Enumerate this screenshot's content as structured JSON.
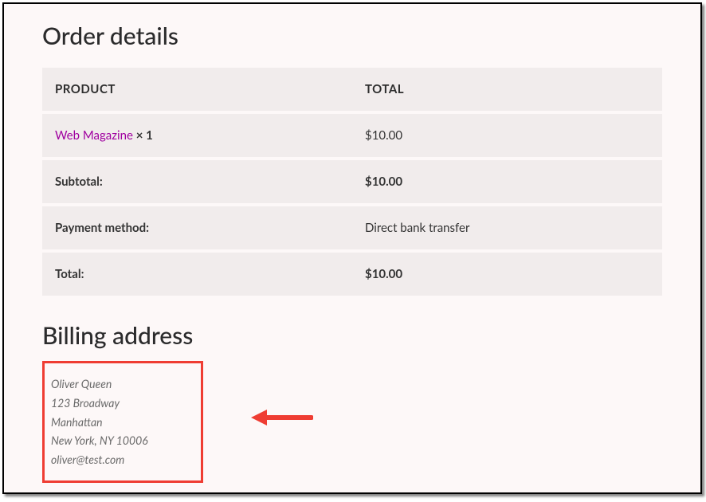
{
  "heading": "Order details",
  "table": {
    "headers": {
      "product": "PRODUCT",
      "total": "TOTAL"
    },
    "item": {
      "name": "Web Magazine",
      "qty": "× 1",
      "total": "$10.00"
    },
    "subtotal": {
      "label": "Subtotal:",
      "value": "$10.00"
    },
    "payment": {
      "label": "Payment method:",
      "value": "Direct bank transfer"
    },
    "total": {
      "label": "Total:",
      "value": "$10.00"
    }
  },
  "billing": {
    "heading": "Billing address",
    "name": "Oliver Queen",
    "street": "123 Broadway",
    "district": "Manhattan",
    "city_state_zip": "New York, NY 10006",
    "email": "oliver@test.com"
  }
}
